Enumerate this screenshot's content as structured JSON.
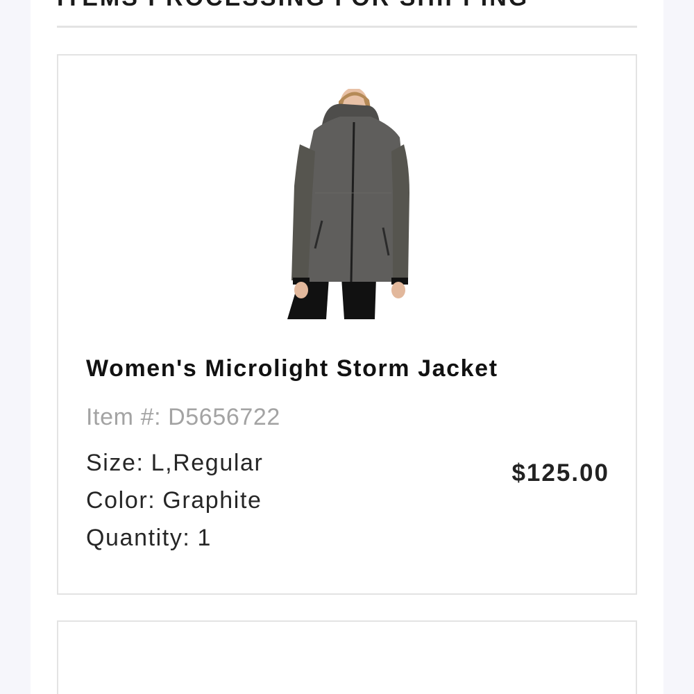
{
  "section": {
    "heading": "ITEMS PROCESSING FOR SHIPPING"
  },
  "product": {
    "image_alt": "Women's Microlight Storm Jacket in Graphite",
    "name": "Women's Microlight Storm Jacket",
    "item_number_label": "Item #:",
    "item_number": "D5656722",
    "size_label": "Size:",
    "size": "L,Regular",
    "color_label": "Color:",
    "color": "Graphite",
    "quantity_label": "Quantity:",
    "quantity": "1",
    "price": "$125.00"
  },
  "colors": {
    "page_background": "#f6f6fb",
    "card_border": "#e3e3e3",
    "muted_text": "#a3a3a3",
    "jacket": "#5f5e5c"
  }
}
